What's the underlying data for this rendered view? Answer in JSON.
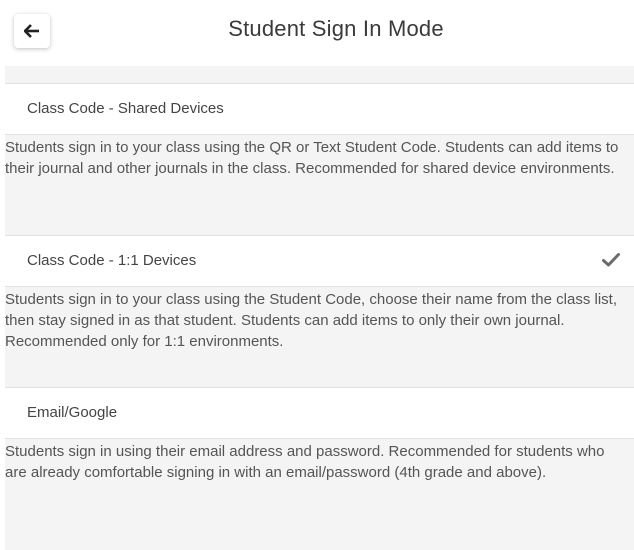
{
  "header": {
    "title": "Student Sign In Mode",
    "back_icon": "arrow-left-icon"
  },
  "options": [
    {
      "label": "Class Code - Shared Devices",
      "description": "Students sign in to your class using the QR or Text Student Code. Students can add items to their journal and other journals in the class. Recommended for shared device environments.",
      "selected": false
    },
    {
      "label": "Class Code - 1:1 Devices",
      "description": "Students sign in to your class using the Student Code, choose their name from the class list, then stay signed in as that student. Students can add items to only their own journal. Recommended only for 1:1 environments.",
      "selected": true,
      "selected_icon": "checkmark-icon"
    },
    {
      "label": "Email/Google",
      "description": "Students sign in using their email address and password. Recommended for students who are already comfortable signing in with an email/password (4th grade and above).",
      "selected": false
    }
  ],
  "colors": {
    "background": "#f4f4f4",
    "row": "#ffffff",
    "text": "#444444",
    "check": "#6b6b6b"
  }
}
